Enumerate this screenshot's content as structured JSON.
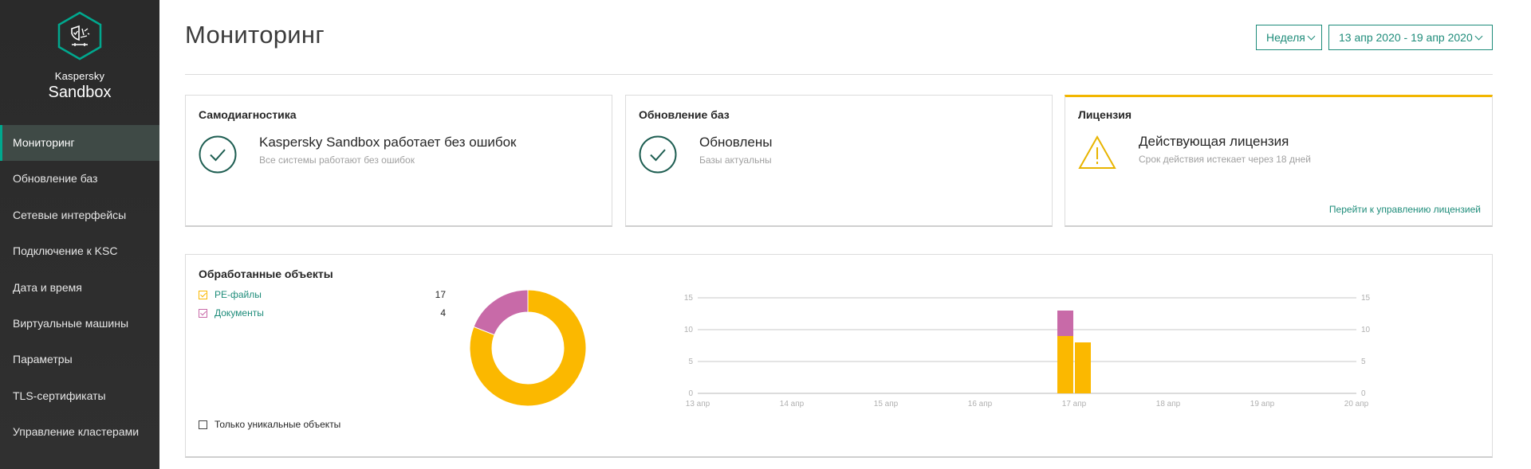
{
  "app": {
    "brand_small": "Kaspersky",
    "brand_big": "Sandbox"
  },
  "sidebar": {
    "items": [
      {
        "label": "Мониторинг",
        "active": true
      },
      {
        "label": "Обновление баз"
      },
      {
        "label": "Сетевые интерфейсы"
      },
      {
        "label": "Подключение к KSC"
      },
      {
        "label": "Дата и время"
      },
      {
        "label": "Виртуальные машины"
      },
      {
        "label": "Параметры"
      },
      {
        "label": "TLS-сертификаты"
      },
      {
        "label": "Управление кластерами"
      }
    ]
  },
  "header": {
    "title": "Мониторинг",
    "period_select": "Неделя",
    "date_range": "13 апр 2020 - 19 апр 2020"
  },
  "cards": {
    "diagnostics": {
      "title": "Самодиагностика",
      "status": "Kaspersky Sandbox работает без ошибок",
      "detail": "Все системы работают без ошибок"
    },
    "updates": {
      "title": "Обновление баз",
      "status": "Обновлены",
      "detail": "Базы актуальны"
    },
    "license": {
      "title": "Лицензия",
      "status": "Действующая лицензия",
      "detail": "Срок действия истекает через 18 дней",
      "link": "Перейти к управлению лицензией"
    }
  },
  "processed": {
    "title": "Обработанные объекты",
    "legend": [
      {
        "label": "PE-файлы",
        "value": "17",
        "color": "#fbb800",
        "checked": true
      },
      {
        "label": "Документы",
        "value": "4",
        "color": "#c86aa8",
        "checked": true
      }
    ],
    "unique_label": "Только уникальные объекты"
  },
  "colors": {
    "accent": "#1e8c7a",
    "pe": "#fbb800",
    "docs": "#c86aa8",
    "warning": "#e8b400"
  },
  "chart_data": [
    {
      "type": "pie",
      "title": "",
      "donut": true,
      "slices": [
        {
          "label": "PE-файлы",
          "value": 17,
          "color": "#fbb800"
        },
        {
          "label": "Документы",
          "value": 4,
          "color": "#c86aa8"
        }
      ]
    },
    {
      "type": "bar",
      "stacked": true,
      "title": "",
      "categories": [
        "13 апр",
        "14 апр",
        "15 апр",
        "16 апр",
        "17 апр",
        "18 апр",
        "19 апр",
        "20 апр"
      ],
      "bars": [
        {
          "x": "17 апр",
          "offset": 0,
          "pe": 9,
          "docs": 4
        },
        {
          "x": "17 апр",
          "offset": 1,
          "pe": 8,
          "docs": 0
        }
      ],
      "series": [
        {
          "name": "PE-файлы",
          "color": "#fbb800"
        },
        {
          "name": "Документы",
          "color": "#c86aa8"
        }
      ],
      "ylim": [
        0,
        15
      ],
      "yticks": [
        0,
        5,
        10,
        15
      ],
      "grid": true
    }
  ]
}
